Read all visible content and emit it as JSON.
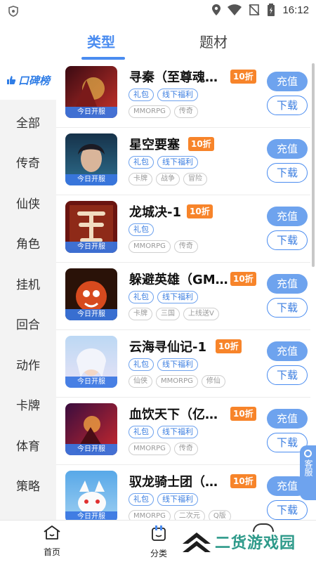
{
  "status_bar": {
    "time": "16:12"
  },
  "tabs": {
    "active": "类型",
    "inactive": "题材"
  },
  "sidebar": {
    "badge": "口碑榜",
    "items": [
      "全部",
      "传奇",
      "仙侠",
      "角色",
      "挂机",
      "回合",
      "动作",
      "卡牌",
      "体育",
      "策略"
    ]
  },
  "games": [
    {
      "name": "寻秦（至尊魂…",
      "discount": "10折",
      "ribbon": "今日开服",
      "tags": [
        "礼包",
        "线下福利"
      ],
      "genres": [
        "MMORPG",
        "传奇"
      ],
      "recharge": "充值",
      "download": "下载"
    },
    {
      "name": "星空要塞",
      "discount": "10折",
      "ribbon": "今日开服",
      "tags": [
        "礼包",
        "线下福利"
      ],
      "genres": [
        "卡牌",
        "战争",
        "冒险"
      ],
      "recharge": "充值",
      "download": "下载"
    },
    {
      "name": "龙城决-1",
      "discount": "10折",
      "ribbon": "今日开服",
      "tags": [
        "礼包"
      ],
      "genres": [
        "MMORPG",
        "传奇"
      ],
      "recharge": "充值",
      "download": "下载"
    },
    {
      "name": "躲避英雄（GM…",
      "discount": "10折",
      "ribbon": "今日开服",
      "tags": [
        "礼包",
        "线下福利"
      ],
      "genres": [
        "卡牌",
        "三国",
        "上线送V"
      ],
      "recharge": "充值",
      "download": "下载"
    },
    {
      "name": "云海寻仙记-1",
      "discount": "10折",
      "ribbon": "今日开服",
      "tags": [
        "礼包",
        "线下福利"
      ],
      "genres": [
        "仙侠",
        "MMORPG",
        "修仙"
      ],
      "recharge": "充值",
      "download": "下载"
    },
    {
      "name": "血饮天下（亿…",
      "discount": "10折",
      "ribbon": "今日开服",
      "tags": [
        "礼包",
        "线下福利"
      ],
      "genres": [
        "MMORPG",
        "传奇"
      ],
      "recharge": "充值",
      "download": "下载"
    },
    {
      "name": "驭龙骑士团（…",
      "discount": "10折",
      "ribbon": "今日开服",
      "tags": [
        "礼包",
        "线下福利"
      ],
      "genres": [
        "MMORPG",
        "二次元",
        "Q版"
      ],
      "recharge": "充值",
      "download": "下载"
    }
  ],
  "service": "客服",
  "bottom_nav": {
    "home": "首页",
    "category": "分类"
  },
  "watermark": "二货游戏园",
  "colors": {
    "accent": "#4a8cf0",
    "discount": "#f7842a",
    "watermark": "#2e9a8a"
  }
}
